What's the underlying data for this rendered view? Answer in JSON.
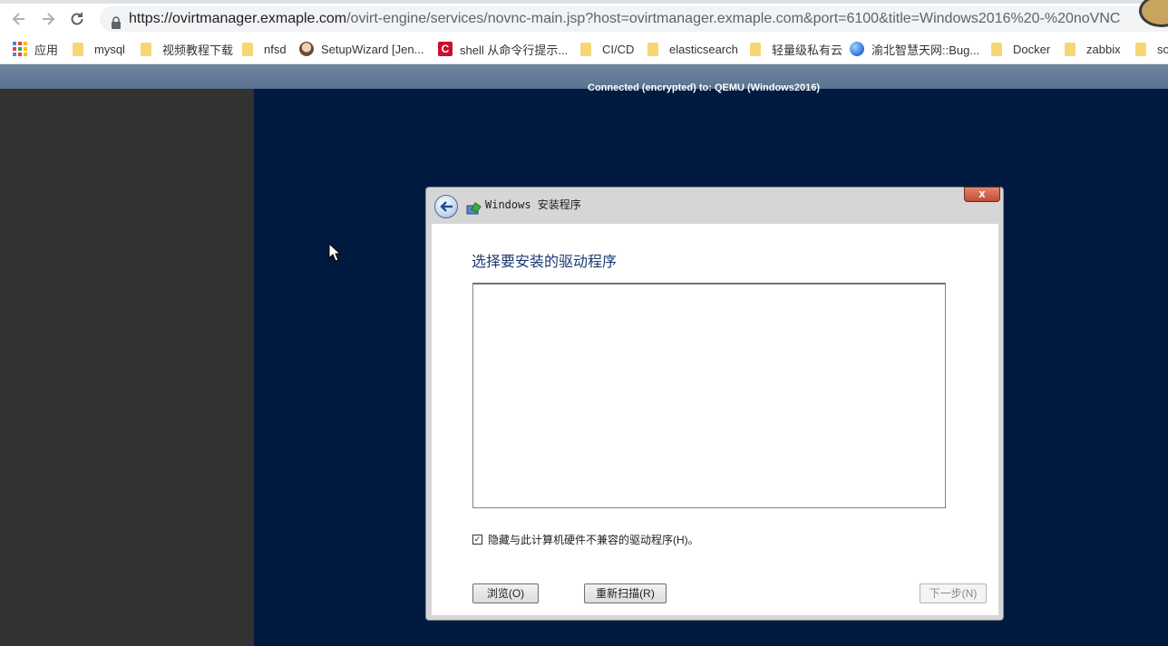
{
  "browser": {
    "url_domain": "https://ovirtmanager.exmaple.com",
    "url_path": "/ovirt-engine/services/novnc-main.jsp?host=ovirtmanager.exmaple.com&port=6100&title=Windows2016%20-%20noVNC",
    "bookmarks": [
      {
        "label": "应用",
        "icon": "apps-grid-icon"
      },
      {
        "label": "mysql",
        "icon": "folder-icon"
      },
      {
        "label": "视频教程下载",
        "icon": "folder-icon"
      },
      {
        "label": "nfsd",
        "icon": "folder-icon"
      },
      {
        "label": "SetupWizard [Jen...",
        "icon": "jenkins-icon"
      },
      {
        "label": "shell 从命令行提示...",
        "icon": "c-logo-icon"
      },
      {
        "label": "CI/CD",
        "icon": "folder-icon"
      },
      {
        "label": "elasticsearch",
        "icon": "folder-icon"
      },
      {
        "label": "轻量级私有云",
        "icon": "folder-icon"
      },
      {
        "label": "渝北智慧天网::Bug...",
        "icon": "globe-icon"
      },
      {
        "label": "Docker",
        "icon": "folder-icon"
      },
      {
        "label": "zabbix",
        "icon": "folder-icon"
      },
      {
        "label": "so",
        "icon": "folder-icon"
      }
    ]
  },
  "vnc": {
    "status": "Connected (encrypted) to: QEMU (Windows2016)"
  },
  "dialog": {
    "title": "Windows 安装程序",
    "close_label": "x",
    "heading": "选择要安装的驱动程序",
    "hide_checkbox_label": "隐藏与此计算机硬件不兼容的驱动程序(H)。",
    "hide_checkbox_checked": true,
    "browse_label": "浏览(O)",
    "rescan_label": "重新扫描(R)",
    "next_label": "下一步(N)"
  },
  "colors": {
    "remote_background": "#001a40",
    "left_panel": "#323232",
    "heading_blue": "#1c3a70"
  }
}
